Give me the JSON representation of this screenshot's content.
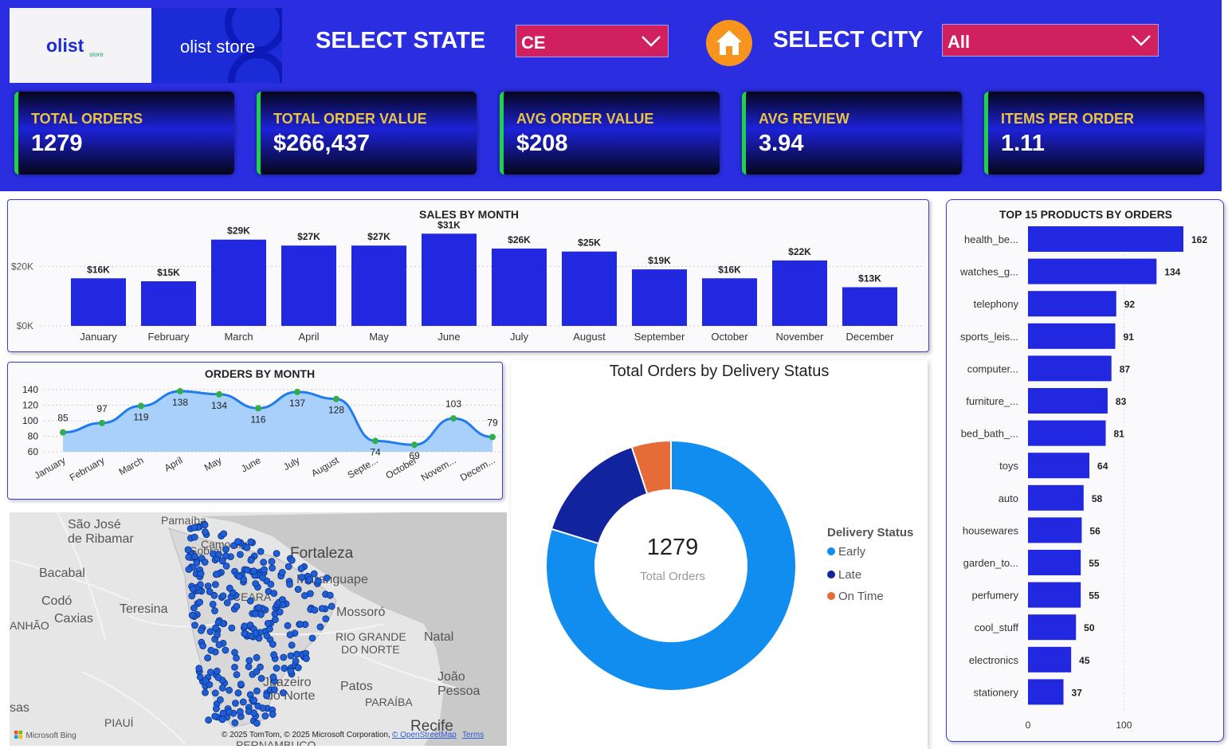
{
  "header": {
    "logo_left_brand": "olist",
    "logo_left_sub": "store",
    "logo_right_text": "olist store",
    "select_state_label": "SELECT STATE",
    "state_value": "CE",
    "select_city_label": "SELECT CITY",
    "city_value": "All",
    "colors": {
      "background": "#2a2ee0",
      "dropdown": "#d0205e",
      "home": "#f7941d"
    }
  },
  "kpis": [
    {
      "title": "TOTAL ORDERS",
      "value": "1279"
    },
    {
      "title": "TOTAL ORDER VALUE",
      "value": "$266,437"
    },
    {
      "title": "AVG ORDER VALUE",
      "value": "$208"
    },
    {
      "title": "AVG REVIEW",
      "value": "3.94"
    },
    {
      "title": "ITEMS PER ORDER",
      "value": "1.11"
    }
  ],
  "chart_data": [
    {
      "type": "bar",
      "title": "SALES BY MONTH",
      "categories": [
        "January",
        "February",
        "March",
        "April",
        "May",
        "June",
        "July",
        "August",
        "September",
        "October",
        "November",
        "December"
      ],
      "values": [
        16,
        15,
        29,
        27,
        27,
        31,
        26,
        25,
        19,
        16,
        22,
        13
      ],
      "data_labels": [
        "$16K",
        "$15K",
        "$29K",
        "$27K",
        "$27K",
        "$31K",
        "$26K",
        "$25K",
        "$19K",
        "$16K",
        "$22K",
        "$13K"
      ],
      "yticks": [
        "$0K",
        "$20K"
      ],
      "ylim": [
        0,
        30
      ],
      "color": "#2227e0"
    },
    {
      "type": "area",
      "title": "ORDERS BY MONTH",
      "categories": [
        "January",
        "February",
        "March",
        "April",
        "May",
        "June",
        "July",
        "August",
        "Septe...",
        "October",
        "Novem...",
        "Decem..."
      ],
      "values": [
        85,
        97,
        119,
        138,
        134,
        116,
        137,
        128,
        74,
        69,
        103,
        79
      ],
      "yticks": [
        60,
        80,
        100,
        120,
        140
      ],
      "ylim": [
        60,
        140
      ],
      "color": "#1f7bf0"
    },
    {
      "type": "pie",
      "title": "Total Orders by Delivery Status",
      "center_value": "1279",
      "center_label": "Total Orders",
      "legend_title": "Delivery Status",
      "slices": [
        {
          "name": "Early",
          "value": 1020,
          "color": "#118df0"
        },
        {
          "name": "Late",
          "value": 194,
          "color": "#12239e"
        },
        {
          "name": "On Time",
          "value": 65,
          "color": "#e66c37"
        }
      ]
    },
    {
      "type": "bar",
      "orientation": "horizontal",
      "title": "TOP 15 PRODUCTS BY ORDERS",
      "categories": [
        "health_be...",
        "watches_g...",
        "telephony",
        "sports_leis...",
        "computer...",
        "furniture_...",
        "bed_bath_...",
        "toys",
        "auto",
        "housewares",
        "garden_to...",
        "perfumery",
        "cool_stuff",
        "electronics",
        "stationery"
      ],
      "values": [
        162,
        134,
        92,
        91,
        87,
        83,
        81,
        64,
        58,
        56,
        55,
        55,
        50,
        45,
        37
      ],
      "xticks": [
        "0",
        "100"
      ],
      "xlim": [
        0,
        162
      ],
      "color": "#2227e0"
    }
  ],
  "map": {
    "city_labels": [
      "São José",
      "de Ribamar",
      "Parnaíba",
      "Fortaleza",
      "Bacabal",
      "Codó",
      "Caxias",
      "Teresina",
      "ANHÃO",
      "CEARÁ",
      "Maranguape",
      "Mossoró",
      "RIO GRANDE",
      "DO NORTE",
      "Natal",
      "João",
      "Pessoa",
      "Patos",
      "PARAÍBA",
      "Juazeiro",
      "do Norte",
      "PIAUÍ",
      "Recife",
      "sas",
      "PERNAMBUCO",
      "Camocim",
      "Sobral"
    ],
    "bing_label": "Microsoft Bing",
    "copyright": "© 2025 TomTom, © 2025 Microsoft Corporation,",
    "osm_link": "© OpenStreetMap",
    "terms_link": "Terms",
    "marker_color": "#1f5fd6"
  }
}
